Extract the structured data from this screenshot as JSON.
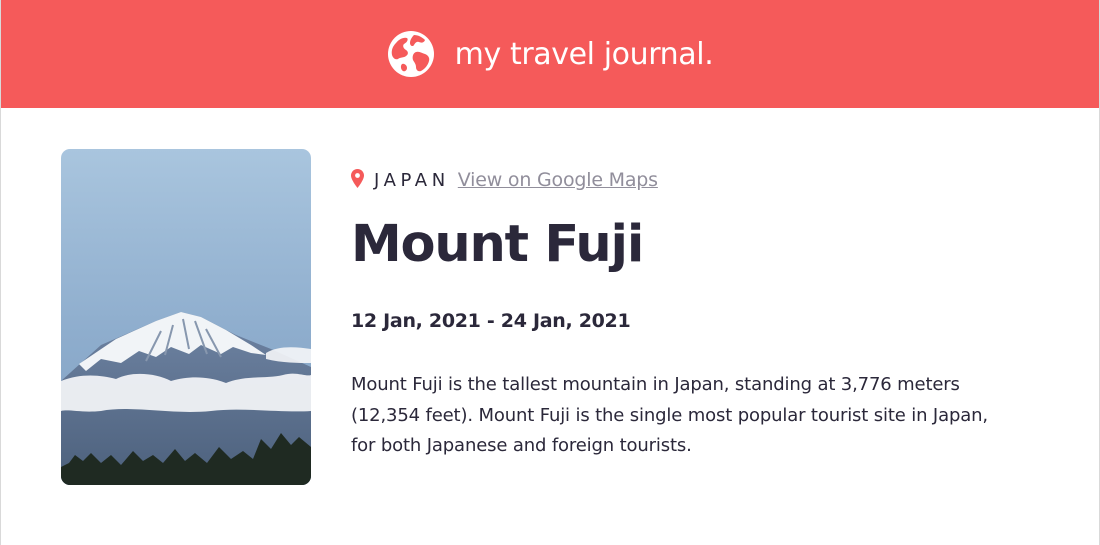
{
  "header": {
    "title": "my travel journal.",
    "icon": "globe-icon",
    "background_color": "#f55a5a"
  },
  "entry": {
    "image_alt": "Mount Fuji",
    "location_icon": "map-pin-icon",
    "country": "JAPAN",
    "maps_link_label": "View on Google Maps",
    "title": "Mount Fuji",
    "dates": "12 Jan, 2021 - 24 Jan, 2021",
    "description": "Mount Fuji is the tallest mountain in Japan, standing at 3,776 meters (12,354 feet). Mount Fuji is the single most popular tourist site in Japan, for both Japanese and foreign tourists."
  },
  "colors": {
    "accent": "#f55a5a",
    "text_primary": "#2b283a",
    "text_muted": "#918e9b"
  }
}
